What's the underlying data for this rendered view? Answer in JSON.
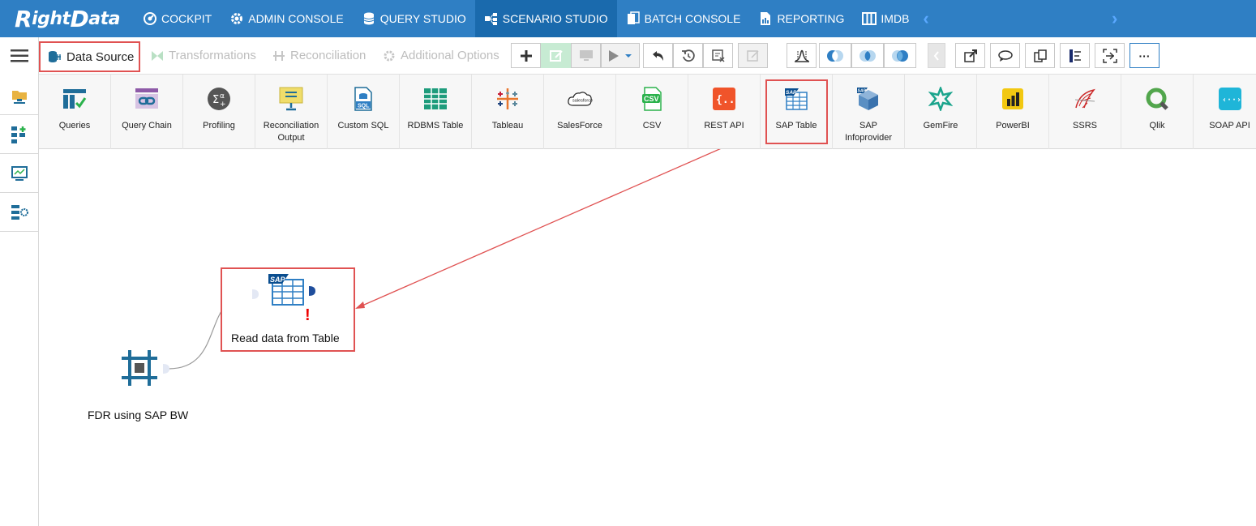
{
  "brand": {
    "logo_r": "R",
    "logo_ight": "ight",
    "logo_d": "D",
    "logo_ata": "ata"
  },
  "nav": {
    "items": [
      {
        "label": "COCKPIT",
        "icon": "cockpit-icon"
      },
      {
        "label": "ADMIN CONSOLE",
        "icon": "gear-icon"
      },
      {
        "label": "QUERY STUDIO",
        "icon": "database-icon"
      },
      {
        "label": "SCENARIO STUDIO",
        "icon": "scenario-icon",
        "active": true
      },
      {
        "label": "BATCH CONSOLE",
        "icon": "batch-icon"
      },
      {
        "label": "REPORTING",
        "icon": "report-icon"
      },
      {
        "label": "IMDB",
        "icon": "imdb-icon"
      }
    ],
    "prev": "‹",
    "next": "›"
  },
  "toolbar": {
    "data_source": "Data Source",
    "transformations": "Transformations",
    "reconciliation": "Reconciliation",
    "additional_options": "Additional Options",
    "more": "···"
  },
  "data_sources": [
    {
      "label": "Queries"
    },
    {
      "label": "Query Chain"
    },
    {
      "label": "Profiling"
    },
    {
      "label": "Reconciliation Output"
    },
    {
      "label": "Custom SQL"
    },
    {
      "label": "RDBMS Table"
    },
    {
      "label": "Tableau"
    },
    {
      "label": "SalesForce"
    },
    {
      "label": "CSV"
    },
    {
      "label": "REST API"
    },
    {
      "label": "SAP Table",
      "selected": true
    },
    {
      "label": "SAP Infoprovider"
    },
    {
      "label": "GemFire"
    },
    {
      "label": "PowerBI"
    },
    {
      "label": "SSRS"
    },
    {
      "label": "Qlik"
    },
    {
      "label": "SOAP API"
    }
  ],
  "canvas": {
    "source_node": {
      "label": "FDR using SAP BW"
    },
    "target_node": {
      "label": "Read data from Table",
      "warning": "!"
    }
  },
  "colors": {
    "nav_bg": "#2f7fc4",
    "nav_active": "#1a6aad",
    "highlight": "#e05252",
    "node_icon": "#1f6d99"
  }
}
